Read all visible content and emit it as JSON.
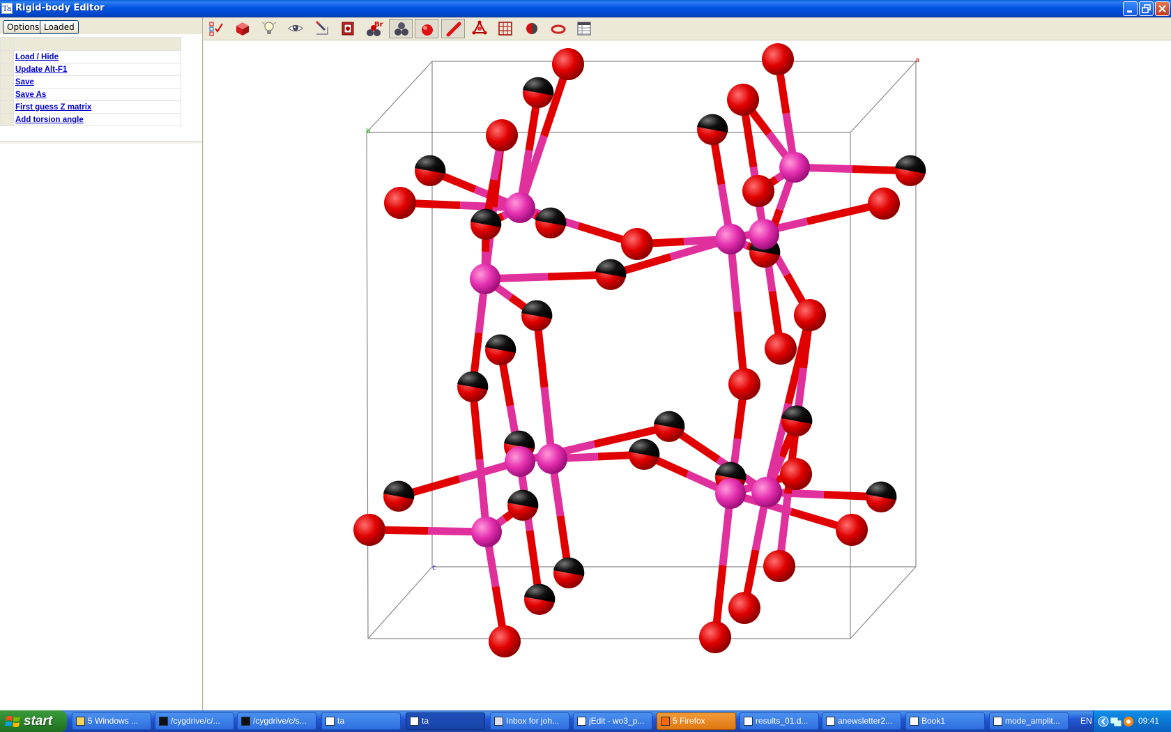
{
  "window": {
    "title": "Rigid-body Editor",
    "icon_text": "Ta",
    "controls": [
      "minimize",
      "restore",
      "close"
    ]
  },
  "left_panel": {
    "options_button": "Options",
    "loaded_button": "Loaded",
    "commands": [
      {
        "label": "Load / Hide"
      },
      {
        "label": "Update Alt-F1"
      },
      {
        "label": "Save"
      },
      {
        "label": "Save As"
      },
      {
        "label": "First guess Z matrix"
      },
      {
        "label": "Add torsion angle"
      }
    ]
  },
  "toolbar": {
    "buttons": [
      {
        "name": "checklist-icon",
        "pressed": false
      },
      {
        "name": "box-icon",
        "pressed": false
      },
      {
        "name": "light-bulb-icon",
        "pressed": false
      },
      {
        "name": "eye-icon",
        "pressed": false
      },
      {
        "name": "brush-icon",
        "pressed": false
      },
      {
        "name": "cube-frame-icon",
        "pressed": false
      },
      {
        "name": "bromine-atoms-icon",
        "pressed": false
      },
      {
        "name": "ball-and-stick-icon",
        "pressed": true
      },
      {
        "name": "spacefill-icon",
        "pressed": true
      },
      {
        "name": "stick-icon",
        "pressed": true
      },
      {
        "name": "polyhedra-icon",
        "pressed": false
      },
      {
        "name": "unit-cell-grid-icon",
        "pressed": false
      },
      {
        "name": "half-sphere-icon",
        "pressed": false
      },
      {
        "name": "ring-icon",
        "pressed": false
      },
      {
        "name": "table-icon",
        "pressed": false
      }
    ],
    "bromine_label": "Br"
  },
  "viewer": {
    "axis_labels": {
      "a": "a",
      "b": "b",
      "c": "c"
    },
    "colors": {
      "tungsten": "#e52fb0",
      "oxygen": "#e00000",
      "oxygen_dark": "#111111",
      "bond_w": "#e0309c",
      "bond_o": "#e00000",
      "cell": "#888888"
    }
  },
  "taskbar": {
    "start_label": "start",
    "tasks": [
      {
        "label": "5 Windows ...",
        "icon": "folder-icon",
        "style": "normal"
      },
      {
        "label": "/cygdrive/c/...",
        "icon": "terminal-icon",
        "style": "normal"
      },
      {
        "label": "/cygdrive/c/s...",
        "icon": "terminal-icon",
        "style": "normal"
      },
      {
        "label": "ta",
        "icon": "ta-icon",
        "style": "normal"
      },
      {
        "label": "ta",
        "icon": "ta-icon",
        "style": "active"
      },
      {
        "label": "Inbox for joh...",
        "icon": "mail-icon",
        "style": "normal"
      },
      {
        "label": "jEdit - wo3_p...",
        "icon": "jedit-icon",
        "style": "normal"
      },
      {
        "label": "5 Firefox",
        "icon": "firefox-icon",
        "style": "orange"
      },
      {
        "label": "results_01.d...",
        "icon": "word-icon",
        "style": "normal"
      },
      {
        "label": "anewsletter2...",
        "icon": "word-icon",
        "style": "normal"
      },
      {
        "label": "Book1",
        "icon": "excel-icon",
        "style": "normal"
      },
      {
        "label": "mode_amplit...",
        "icon": "excel-icon",
        "style": "normal"
      }
    ],
    "language": "EN",
    "clock": "09:41"
  }
}
